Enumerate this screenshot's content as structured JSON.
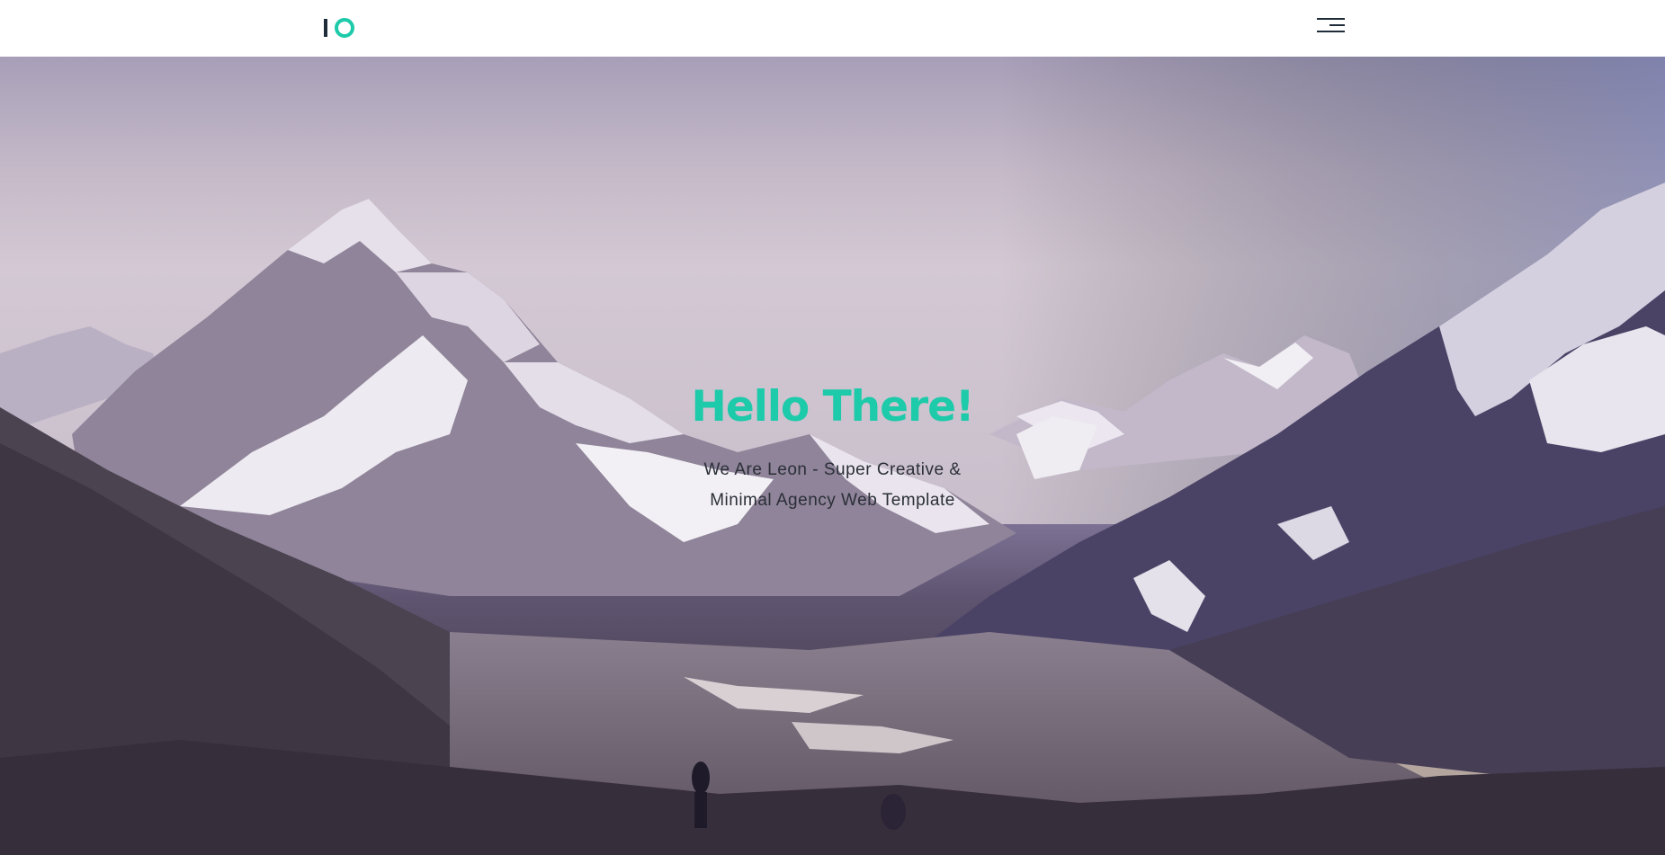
{
  "header": {
    "logo_icon": "io-logo-icon",
    "menu_icon": "hamburger-menu-icon"
  },
  "hero": {
    "title": "Hello There!",
    "subtitle_line1": "We Are Leon - Super Creative &",
    "subtitle_line2": "Minimal Agency Web Template",
    "background_image": "snowy-mountain-valley-image"
  },
  "colors": {
    "accent": "#1dcaa9",
    "dark": "#1f2d3a",
    "text": "#2b2f38"
  }
}
